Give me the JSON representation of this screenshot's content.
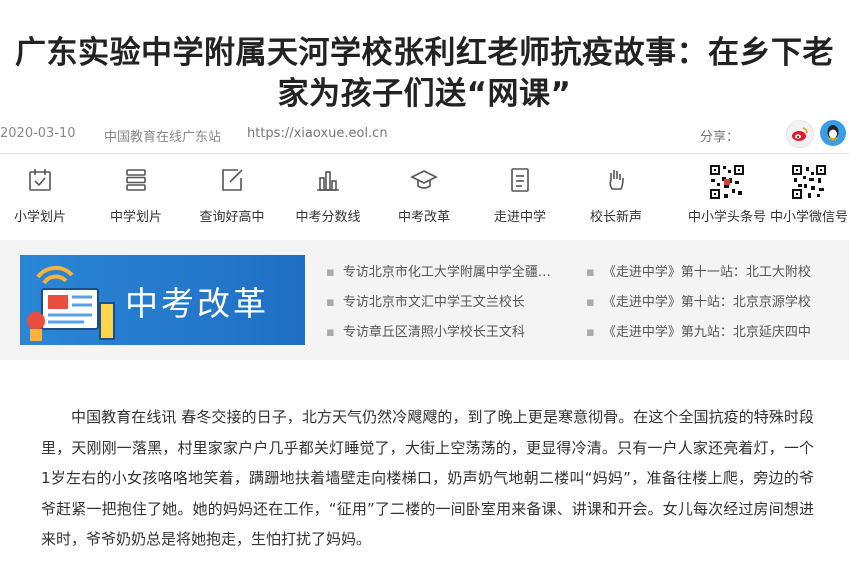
{
  "article": {
    "title": "广东实验中学附属天河学校张利红老师抗疫故事：在乡下老家为孩子们送“网课”",
    "date": "2020-03-10",
    "site": "中国教育在线广东站",
    "url": "https://xiaoxue.eol.cn",
    "share_label": "分享：",
    "body": "中国教育在线讯 春冬交接的日子，北方天气仍然冷飕飕的，到了晚上更是寒意彻骨。在这个全国抗疫的特殊时段里，天刚刚一落黑，村里家家户户几乎都关灯睡觉了，大街上空荡荡的，更显得冷清。只有一户人家还亮着灯，一个1岁左右的小女孩咯咯地笑着，蹒跚地扶着墙壁走向楼梯口，奶声奶气地朝二楼叫“妈妈”，准备往楼上爬，旁边的爷爷赶紧一把抱住了她。她的妈妈还在工作，“征用”了二楼的一间卧室用来备课、讲课和开会。女儿每次经过房间想进来时，爷爷奶奶总是将她抱走，生怕打扰了妈妈。"
  },
  "share": {
    "weibo_icon": "weibo-icon",
    "qq_icon": "qq-icon"
  },
  "nav": {
    "items": [
      {
        "label": "小学划片",
        "icon": "calendar-check-icon"
      },
      {
        "label": "中学划片",
        "icon": "stack-icon"
      },
      {
        "label": "查询好高中",
        "icon": "edit-icon"
      },
      {
        "label": "中考分数线",
        "icon": "bar-chart-icon"
      },
      {
        "label": "中考改革",
        "icon": "graduation-cap-icon"
      },
      {
        "label": "走进中学",
        "icon": "document-icon"
      },
      {
        "label": "校长新声",
        "icon": "hand-icon"
      },
      {
        "label": "中小学头条号",
        "icon": "qr-code-icon"
      },
      {
        "label": "中小学微信号",
        "icon": "qr-code-icon"
      }
    ]
  },
  "banner": {
    "title": "中考改革",
    "accent": "#2a84d4"
  },
  "related": {
    "col1": [
      "专访北京市化工大学附属中学全疆…",
      "专访北京市文汇中学王文兰校长",
      "专访章丘区清照小学校长王文科"
    ],
    "col2": [
      "《走进中学》第十一站：北工大附校",
      "《走进中学》第十站：北京京源学校",
      "《走进中学》第九站：北京延庆四中"
    ]
  }
}
